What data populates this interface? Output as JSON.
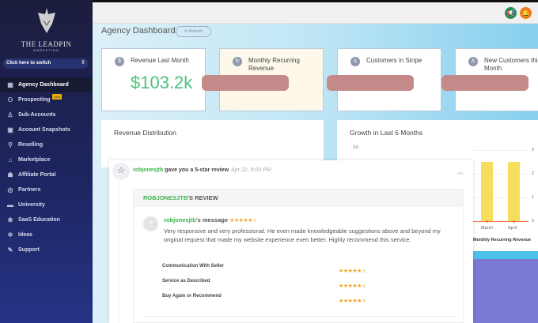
{
  "sidebar": {
    "logo_text": "THE LEADPIN",
    "logo_sub": "MARKETING",
    "switch_label": "Click here to switch",
    "items": [
      {
        "label": "Agency Dashboard",
        "icon": "dashboard-icon",
        "glyph": "▦"
      },
      {
        "label": "Prospecting",
        "icon": "prospecting-icon",
        "glyph": "⚇",
        "badge": "new"
      },
      {
        "label": "Sub-Accounts",
        "icon": "user-icon",
        "glyph": "♙"
      },
      {
        "label": "Account Snapshots",
        "icon": "snapshot-icon",
        "glyph": "▣"
      },
      {
        "label": "Reselling",
        "icon": "reselling-icon",
        "glyph": "⚲"
      },
      {
        "label": "Marketplace",
        "icon": "bag-icon",
        "glyph": "⌂"
      },
      {
        "label": "Affiliate Portal",
        "icon": "affiliate-icon",
        "glyph": "☗"
      },
      {
        "label": "Partners",
        "icon": "handshake-icon",
        "glyph": "◎"
      },
      {
        "label": "University",
        "icon": "graduation-cap-icon",
        "glyph": "▬"
      },
      {
        "label": "SaaS Education",
        "icon": "education-icon",
        "glyph": "❀"
      },
      {
        "label": "Ideas",
        "icon": "lightbulb-icon",
        "glyph": "✲"
      },
      {
        "label": "Support",
        "icon": "wrench-icon",
        "glyph": "✎"
      }
    ]
  },
  "header": {
    "title": "Agency Dashboard",
    "refresh": "⟳ Refresh"
  },
  "cards": [
    {
      "label": "Revenue Last Month",
      "value": "$103.2k",
      "glyph": "$"
    },
    {
      "label": "Monthly Recurring Revenue",
      "value": "",
      "glyph": "↻"
    },
    {
      "label": "Customers in Stripe",
      "value": "",
      "glyph": "♙"
    },
    {
      "label": "New Customers this Month",
      "value": "",
      "glyph": "♙"
    }
  ],
  "panels": {
    "revenue_distribution": "Revenue Distribution",
    "growth": "Growth in Last 6 Months"
  },
  "review": {
    "user": "robjonesjtb",
    "action": "gave you a 5-star review",
    "date": "Apr 22, 9:00 PM",
    "box_user": "ROBJONESJTB",
    "box_suffix": "'S REVIEW",
    "avatar": "R",
    "msg_suffix": "'s message",
    "stars": "★★★★★",
    "rating": "5",
    "text": "Very responsive and very professional. He even made knowledgeable suggestions above and beyond my original request that made my website experience even better. Highly recommend this service.",
    "criteria": [
      {
        "label": "Communication With Seller",
        "rating": "5"
      },
      {
        "label": "Service as Described",
        "rating": "5"
      },
      {
        "label": "Buy Again or Recommend",
        "rating": "5"
      }
    ]
  },
  "chart_data": {
    "type": "bar",
    "title": "Growth in Last 6 Months",
    "categories": [
      "March",
      "April"
    ],
    "values": [
      2.5,
      2.5
    ],
    "y_left_top": "3.6",
    "y_ticks": [
      "3",
      "2",
      "1",
      "0"
    ],
    "ylim": [
      0,
      3
    ],
    "legend": "Monthly Recurring Revenue",
    "colors": {
      "bar": "#f6de5c",
      "line": "#f0784b"
    }
  }
}
